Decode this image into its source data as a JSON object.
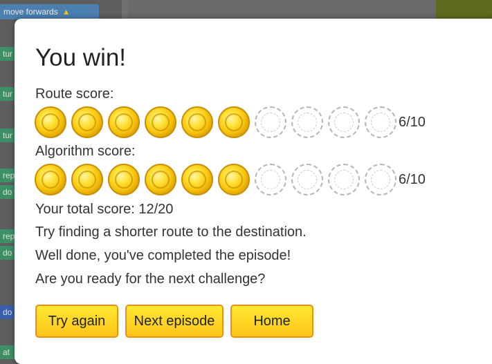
{
  "background": {
    "top_block_label": "move forwards",
    "side_stubs": [
      "tur",
      "tur",
      "tur",
      "rep",
      "do",
      "rep",
      "do",
      "do",
      "at"
    ]
  },
  "modal": {
    "title": "You win!",
    "route_label": "Route score:",
    "route_score": "6/10",
    "route_coins_earned": 6,
    "route_coins_total": 10,
    "algorithm_label": "Algorithm score:",
    "algorithm_score": "6/10",
    "algorithm_coins_earned": 6,
    "algorithm_coins_total": 10,
    "total_score": "Your total score: 12/20",
    "message_1": "Try finding a shorter route to the destination.",
    "message_2": "Well done, you've completed the episode!",
    "message_3": "Are you ready for the next challenge?",
    "buttons": {
      "try_again": "Try again",
      "next_episode": "Next episode",
      "home": "Home"
    }
  },
  "colors": {
    "button_fill": "#ffd820",
    "button_border": "#f08d12",
    "coin_gold": "#f6c40b"
  }
}
